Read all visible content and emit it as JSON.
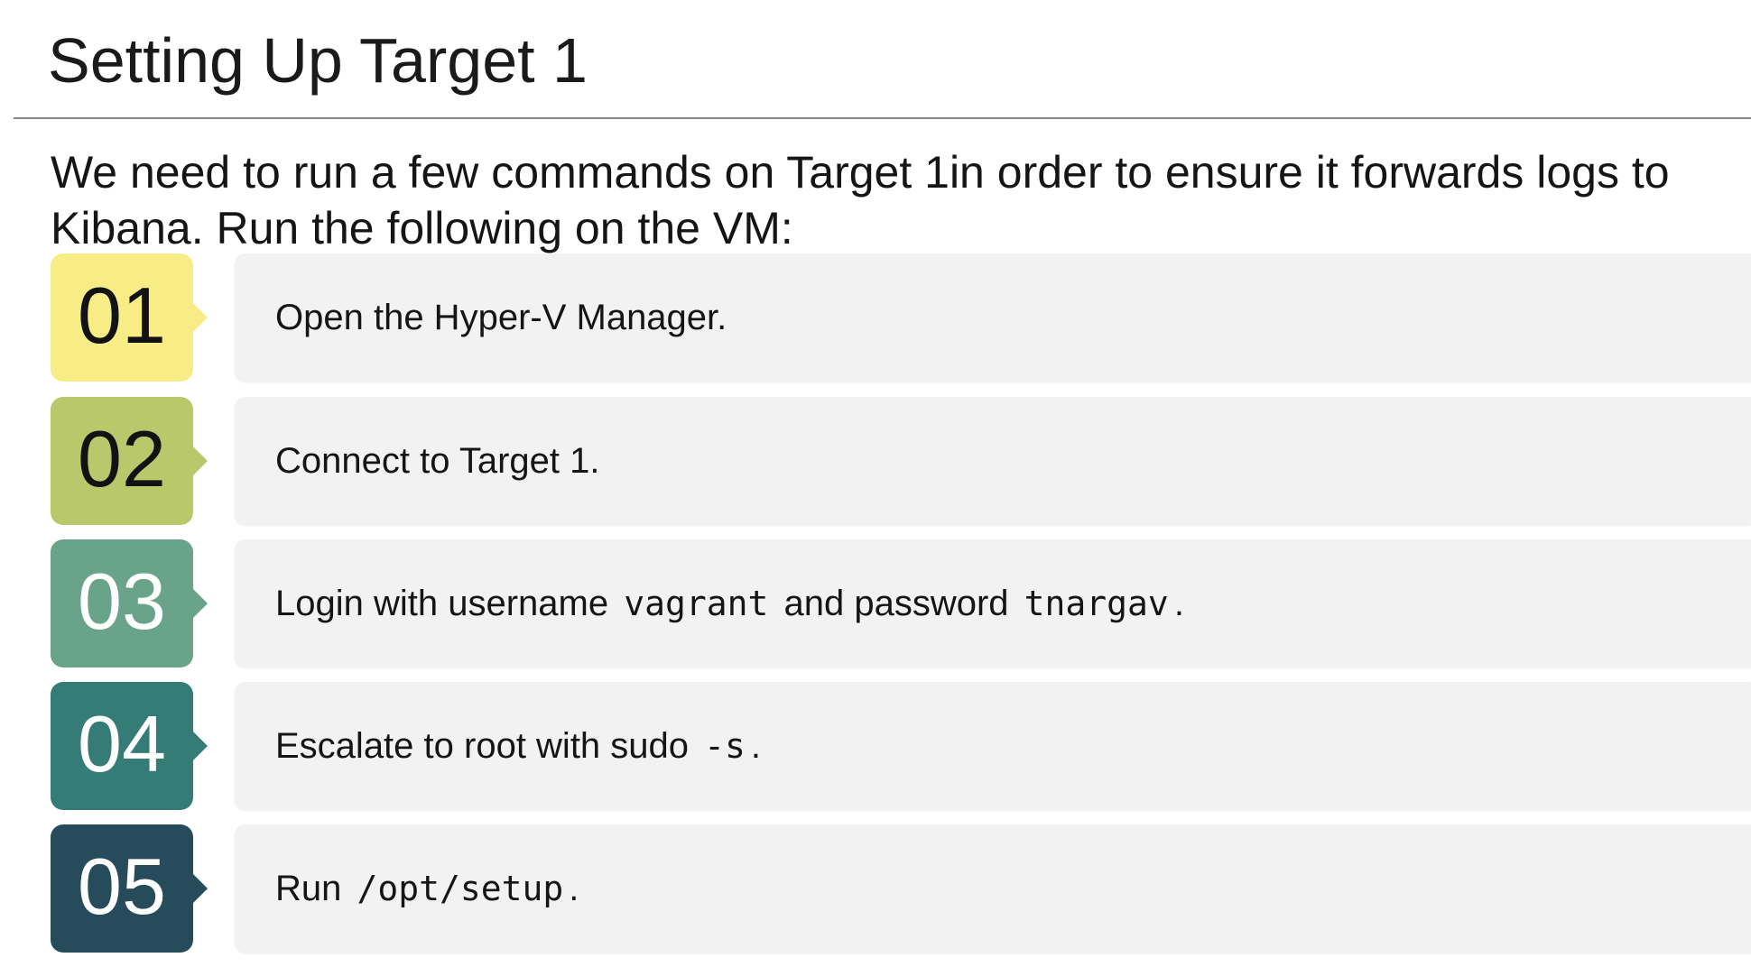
{
  "slide": {
    "title": "Setting Up Target 1",
    "intro": "We need to run a few commands on Target 1in order to ensure it forwards logs to Kibana. Run the following on the VM:"
  },
  "steps": [
    {
      "number": "01",
      "badge_color": "#f7ec86",
      "number_color": "#121212",
      "parts": [
        "Open the Hyper-V Manager."
      ]
    },
    {
      "number": "02",
      "badge_color": "#b9c86b",
      "number_color": "#121212",
      "parts": [
        "Connect to Target 1."
      ]
    },
    {
      "number": "03",
      "badge_color": "#68a38a",
      "number_color": "#ffffff",
      "parts": [
        "Login with username ",
        "vagrant",
        " and password ",
        "tnargav",
        "."
      ]
    },
    {
      "number": "04",
      "badge_color": "#357c77",
      "number_color": "#ffffff",
      "parts": [
        "Escalate to root with sudo ",
        "-s",
        "."
      ]
    },
    {
      "number": "05",
      "badge_color": "#264b5b",
      "number_color": "#ffffff",
      "parts": [
        "Run ",
        "/opt/setup",
        "."
      ]
    }
  ]
}
